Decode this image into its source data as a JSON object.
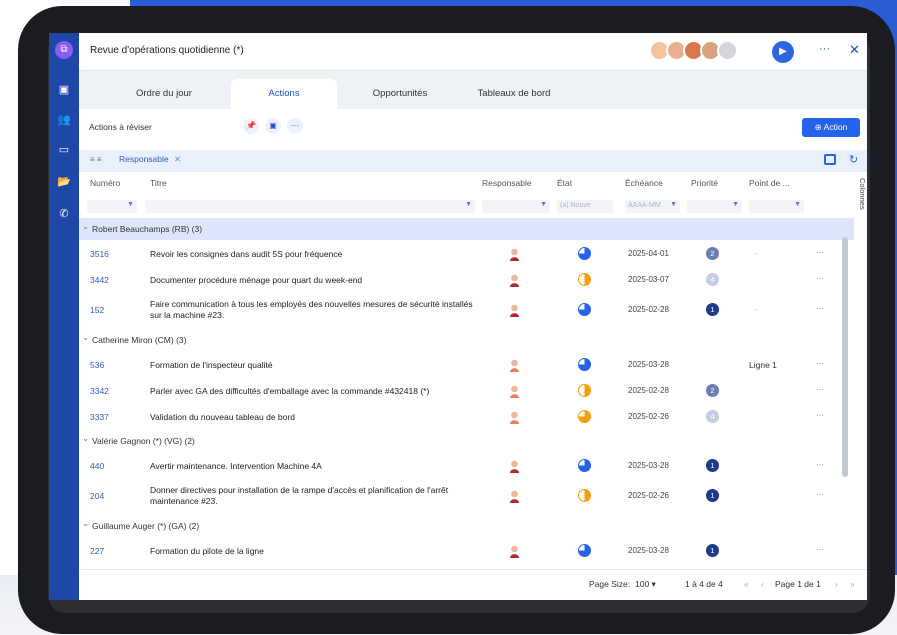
{
  "window": {
    "title": "Revue d'opérations quotidienne (*)",
    "play_icon": "play-icon",
    "more_label": "···",
    "close_label": "✕"
  },
  "tabs": [
    "Ordre du jour",
    "Actions",
    "Opportunités",
    "Tableaux de bord"
  ],
  "active_tab": "Actions",
  "toolbar": {
    "view_value": "Actions à réviser",
    "pin_icon": "pin-icon",
    "save_icon": "save-icon",
    "more_label": "···",
    "action_button": "⊕ Action"
  },
  "group_bar": {
    "chip": "Responsable",
    "chip_close": "✕"
  },
  "columns": {
    "numero": "Numéro",
    "titre": "Titre",
    "responsable": "Responsable",
    "etat": "État",
    "echeance": "Échéance",
    "priorite": "Priorité",
    "point": "Point de ..."
  },
  "filters": {
    "etat_placeholder": "(a) Nouve",
    "echeance_placeholder": "AAAA-MM"
  },
  "side_panel": "Colonnes",
  "groups": [
    {
      "label": "Robert Beauchamps (RB) (3)",
      "rows": [
        {
          "num": "3516",
          "titre": "Revoir les consignes dans audit 5S pour fréquence",
          "echeance": "2025-04-01",
          "prio": "2",
          "point": "-",
          "etat_color": "#2563eb"
        },
        {
          "num": "3442",
          "titre": "Documenter procédure ménage pour quart du week-end",
          "echeance": "2025-03-07",
          "prio": "4",
          "point": "",
          "etat_color": "#f59e0b"
        },
        {
          "num": "152",
          "titre": "Faire communication à tous les employés des nouvelles mesures de sécurité installés sur la machine #23.",
          "echeance": "2025-02-28",
          "prio": "1",
          "point": "-",
          "etat_color": "#2563eb"
        }
      ]
    },
    {
      "label": "Catherine Miron (CM) (3)",
      "rows": [
        {
          "num": "536",
          "titre": "Formation de l'inspecteur qualité",
          "echeance": "2025-03-28",
          "prio": "",
          "point": "Ligne 1",
          "etat_color": "#2563eb"
        },
        {
          "num": "3342",
          "titre": "Parler avec GA des difficultés d'emballage avec la commande #432418 (*)",
          "echeance": "2025-02-28",
          "prio": "2",
          "point": "",
          "etat_color": "#f59e0b"
        },
        {
          "num": "3337",
          "titre": "Validation du nouveau tableau de bord",
          "echeance": "2025-02-26",
          "prio": "4",
          "point": "",
          "etat_color": "#f59e0b"
        }
      ]
    },
    {
      "label": "Valérie Gagnon (*) (VG) (2)",
      "rows": [
        {
          "num": "440",
          "titre": "Avertir maintenance. Intervention Machine 4A",
          "echeance": "2025-03-28",
          "prio": "1",
          "point": "",
          "etat_color": "#2563eb"
        },
        {
          "num": "204",
          "titre": "Donner directives pour installation de la rampe d'accès et planification de l'arrêt maintenance #23.",
          "echeance": "2025-02-26",
          "prio": "1",
          "point": "",
          "etat_color": "#f59e0b"
        }
      ]
    },
    {
      "label": "Guillaume Auger (*) (GA) (2)",
      "rows": [
        {
          "num": "227",
          "titre": "Formation du pilote de la ligne",
          "echeance": "2025-03-28",
          "prio": "1",
          "point": "",
          "etat_color": "#2563eb"
        }
      ]
    }
  ],
  "footer": {
    "page_size_label": "Page Size:",
    "page_size_value": "100 ▾",
    "range": "1 à 4 de 4",
    "first": "«",
    "prev": "‹",
    "page_label": "Page 1 de 1",
    "next": "›",
    "last": "»"
  },
  "colors": {
    "accent": "#2563eb",
    "rail": "#1e47a8",
    "background_blue": "#2a5cd6"
  }
}
